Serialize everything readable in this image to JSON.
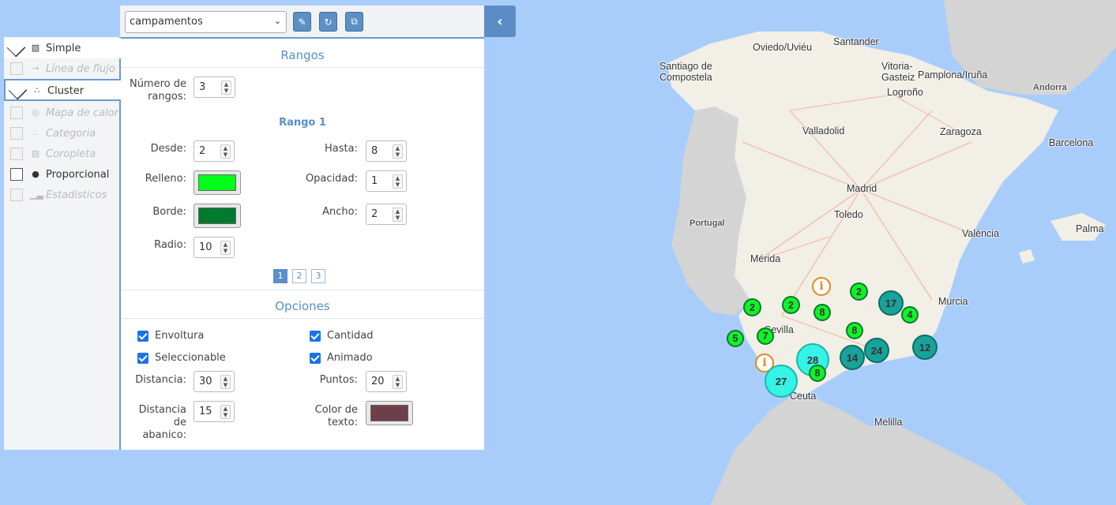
{
  "toolbar": {
    "layer_select": "campamentos",
    "buttons": [
      "brush-icon",
      "refresh-icon",
      "copy-icon"
    ],
    "collapse_icon": "chevron-left-icon"
  },
  "sidebar": {
    "items": [
      {
        "label": "Simple",
        "icon": "simple-icon",
        "checked": true,
        "enabled": true
      },
      {
        "label": "Línea de flujo",
        "icon": "arrow-right-icon",
        "checked": false,
        "enabled": false
      },
      {
        "label": "Cluster",
        "icon": "cluster-icon",
        "checked": true,
        "enabled": true
      },
      {
        "label": "Mapa de calor",
        "icon": "heatmap-icon",
        "checked": false,
        "enabled": false
      },
      {
        "label": "Categoria",
        "icon": "category-icon",
        "checked": false,
        "enabled": false
      },
      {
        "label": "Coropleta",
        "icon": "choropleth-icon",
        "checked": false,
        "enabled": false
      },
      {
        "label": "Proporcional",
        "icon": "proportional-icon",
        "checked": false,
        "enabled": true
      },
      {
        "label": "Estadisticos",
        "icon": "bar-chart-icon",
        "checked": false,
        "enabled": false
      }
    ]
  },
  "panel": {
    "rangos_title": "Rangos",
    "num_rangos_label": "Número de rangos:",
    "num_rangos": "3",
    "rango_title": "Rango 1",
    "desde_label": "Desde:",
    "desde": "2",
    "hasta_label": "Hasta:",
    "hasta": "8",
    "relleno_label": "Relleno:",
    "relleno_color": "#00ff18",
    "opacidad_label": "Opacidad:",
    "opacidad": "1",
    "borde_label": "Borde:",
    "borde_color": "#007a2e",
    "ancho_label": "Ancho:",
    "ancho": "2",
    "radio_label": "Radio:",
    "radio": "10",
    "pages": [
      "1",
      "2",
      "3"
    ],
    "active_page": "1",
    "opciones_title": "Opciones",
    "options": {
      "envoltura": "Envoltura",
      "cantidad": "Cantidad",
      "seleccionable": "Seleccionable",
      "animado": "Animado"
    },
    "distancia_label": "Distancia:",
    "distancia": "30",
    "puntos_label": "Puntos:",
    "puntos": "20",
    "distancia_abanico_label": "Distancia de abanico:",
    "distancia_abanico": "15",
    "color_texto_label": "Color de texto:",
    "color_texto": "#6e3f4a"
  },
  "map": {
    "labels": {
      "santander": "Santander",
      "oviedo": "Oviedo/Uviéu",
      "santiago": "Santiago de Compostela",
      "vitoria": "Vitoria-Gasteiz",
      "pamplona": "Pamplona/Iruña",
      "logrono": "Logroño",
      "andorra": "Andorra",
      "valladolid": "Valladolid",
      "zaragoza": "Zaragoza",
      "barcelona": "Barcelona",
      "madrid": "Madrid",
      "toledo": "Toledo",
      "portugal": "Portugal",
      "valencia": "València",
      "palma": "Palma",
      "merida": "Mérida",
      "murcia": "Murcia",
      "sevilla": "Sevilla",
      "ceuta": "Ceuta",
      "melilla": "Melilla"
    },
    "clusters": [
      "2",
      "2",
      "2",
      "8",
      "17",
      "4",
      "5",
      "7",
      "8",
      "28",
      "14",
      "24",
      "12",
      "27",
      "8"
    ],
    "colors": {
      "water": "#a9cdfb",
      "land": "#f1efe6",
      "other_land": "#d4d4d4"
    }
  }
}
